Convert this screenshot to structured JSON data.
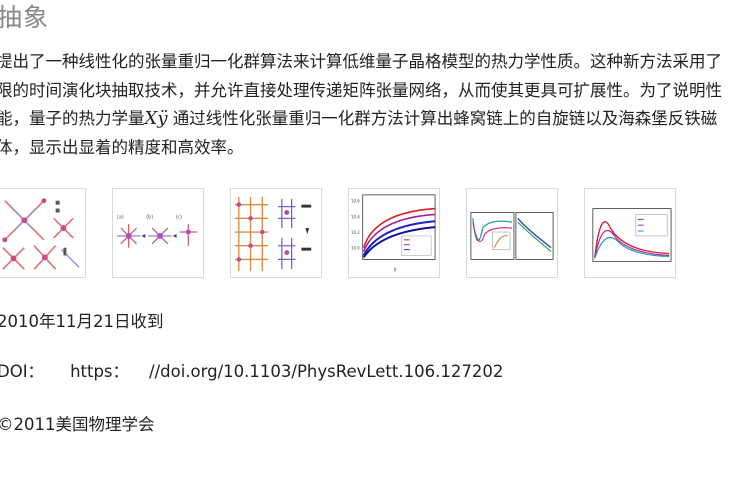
{
  "section_title": "抽象",
  "abstract": {
    "line1": "提出了一种线性化的张量重归一化群算法来计算低维量子晶格模型的热力学性质。这种新方法采用了",
    "line2": "限的时间演化块抽取技术，并允许直接处理传递矩阵张量网络，从而使其更具可扩展性。为了说明性",
    "line3_before": "能，量子的热力学量",
    "line3_model": "Xÿ",
    "line3_after": " 通过线性化张量重归一化群方法计算出蜂窝链上的自旋链以及海森堡反铁磁",
    "line4": "体，显示出显着的精度和高效率。"
  },
  "figures": [
    {
      "name": "figure-1-thumbnail",
      "kind": "tensor-network"
    },
    {
      "name": "figure-2-thumbnail",
      "kind": "tensor-steps"
    },
    {
      "name": "figure-3-thumbnail",
      "kind": "tensor-grid"
    },
    {
      "name": "figure-4-thumbnail",
      "kind": "curves"
    },
    {
      "name": "figure-5-thumbnail",
      "kind": "multi-panel-plot"
    },
    {
      "name": "figure-6-thumbnail",
      "kind": "peak-plot"
    }
  ],
  "received": "2010年11月21日收到",
  "doi": {
    "label": "DOI：",
    "scheme": "https：",
    "path": "//doi.org/10.1103/PhysRevLett.106.127202"
  },
  "copyright": "©2011美国物理学会",
  "colors": {
    "heading": "#888888",
    "text": "#222222",
    "thumb_border": "#d9d9d9"
  }
}
